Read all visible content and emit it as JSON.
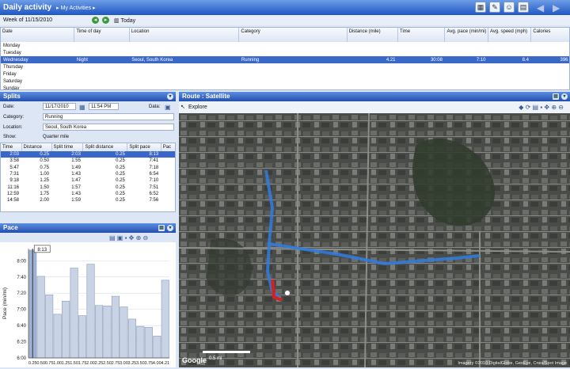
{
  "header": {
    "title": "Daily activity",
    "breadcrumb": "My Activities"
  },
  "toolbar_icons": [
    "calendar-icon",
    "wrench-icon",
    "person-icon",
    "clipboard-icon"
  ],
  "week": {
    "label": "Week of 11/15/2010",
    "today": "Today"
  },
  "grid": {
    "columns": [
      "Date",
      "Time of day",
      "Location",
      "Category",
      "Distance (mile)",
      "Time",
      "Avg. pace (min/mi)",
      "Avg. speed (mph)",
      "Calories"
    ],
    "rows": [
      [
        "Monday",
        "",
        "",
        "",
        "",
        "",
        "",
        "",
        ""
      ],
      [
        "Tuesday",
        "",
        "",
        "",
        "",
        "",
        "",
        "",
        ""
      ],
      [
        "Wednesday",
        "Night",
        "Seoul, South Korea",
        "Running",
        "4.21",
        "30:08",
        "7:10",
        "8.4",
        "396"
      ],
      [
        "Thursday",
        "",
        "",
        "",
        "",
        "",
        "",
        "",
        ""
      ],
      [
        "Friday",
        "",
        "",
        "",
        "",
        "",
        "",
        "",
        ""
      ],
      [
        "Saturday",
        "",
        "",
        "",
        "",
        "",
        "",
        "",
        ""
      ],
      [
        "Sunday",
        "",
        "",
        "",
        "",
        "",
        "",
        "",
        ""
      ]
    ]
  },
  "splits": {
    "title": "Splits",
    "date_label": "Date:",
    "date": "11/17/2010",
    "time": "11:54 PM",
    "data_label": "Data:",
    "category_label": "Category:",
    "category": "Running",
    "location_label": "Location:",
    "location": "Seoul, South Korea",
    "show_label": "Show:",
    "show": "Quarter mile",
    "columns": [
      "Time",
      "Distance",
      "Split time",
      "Split distance",
      "Split pace",
      "Pac"
    ],
    "rows": [
      [
        "2:03",
        "0.25",
        "2:03",
        "0.25",
        "8:13"
      ],
      [
        "3:58",
        "0.50",
        "1:55",
        "0.25",
        "7:41"
      ],
      [
        "5:47",
        "0.75",
        "1:49",
        "0.25",
        "7:18"
      ],
      [
        "7:31",
        "1.00",
        "1:43",
        "0.25",
        "6:54"
      ],
      [
        "9:18",
        "1.25",
        "1:47",
        "0.25",
        "7:10"
      ],
      [
        "11:16",
        "1.50",
        "1:57",
        "0.25",
        "7:51"
      ],
      [
        "12:59",
        "1.75",
        "1:43",
        "0.25",
        "6:52"
      ],
      [
        "14:58",
        "2.00",
        "1:59",
        "0.25",
        "7:56"
      ]
    ]
  },
  "pace": {
    "title": "Pace"
  },
  "chart_data": {
    "type": "bar",
    "ylabel": "Pace (min/mi)",
    "ylim": [
      6.0,
      8.25
    ],
    "yticks": [
      "6:00",
      "6:20",
      "6:40",
      "7:00",
      "7:20",
      "7:40",
      "8:00"
    ],
    "categories": [
      "0.25",
      "0.50",
      "0.75",
      "1.00",
      "1.25",
      "1.50",
      "1.75",
      "2.00",
      "2.25",
      "2.50",
      "2.75",
      "3.00",
      "3.25",
      "3.50",
      "3.75",
      "4.00",
      "4.21"
    ],
    "xtick_labels": [
      "0.25",
      "0.50",
      "0.75",
      "1.00",
      "1.25",
      "1.50",
      "1.75",
      "2.00",
      "2.25",
      "2.50",
      "2.75",
      "3.00",
      "3.25",
      "3.50",
      "3.75",
      "4.00",
      "4.21"
    ],
    "values": [
      8.22,
      7.68,
      7.3,
      6.9,
      7.17,
      7.85,
      6.87,
      7.93,
      7.08,
      7.07,
      7.27,
      7.05,
      6.8,
      6.65,
      6.63,
      6.45,
      7.6
    ],
    "highlight_label": "8:13",
    "grid": true
  },
  "route": {
    "title": "Route : Satellite",
    "explore": "Explore",
    "scale": "0.5 mi",
    "copyright": "Imagery ©2010 DigitalGlobe, GeoEye, Cnes/Spot Image"
  },
  "colors": {
    "header": "#1f56c4",
    "selection": "#3968c9",
    "route": "#2f7de0",
    "bar": "#c9d3e6"
  }
}
